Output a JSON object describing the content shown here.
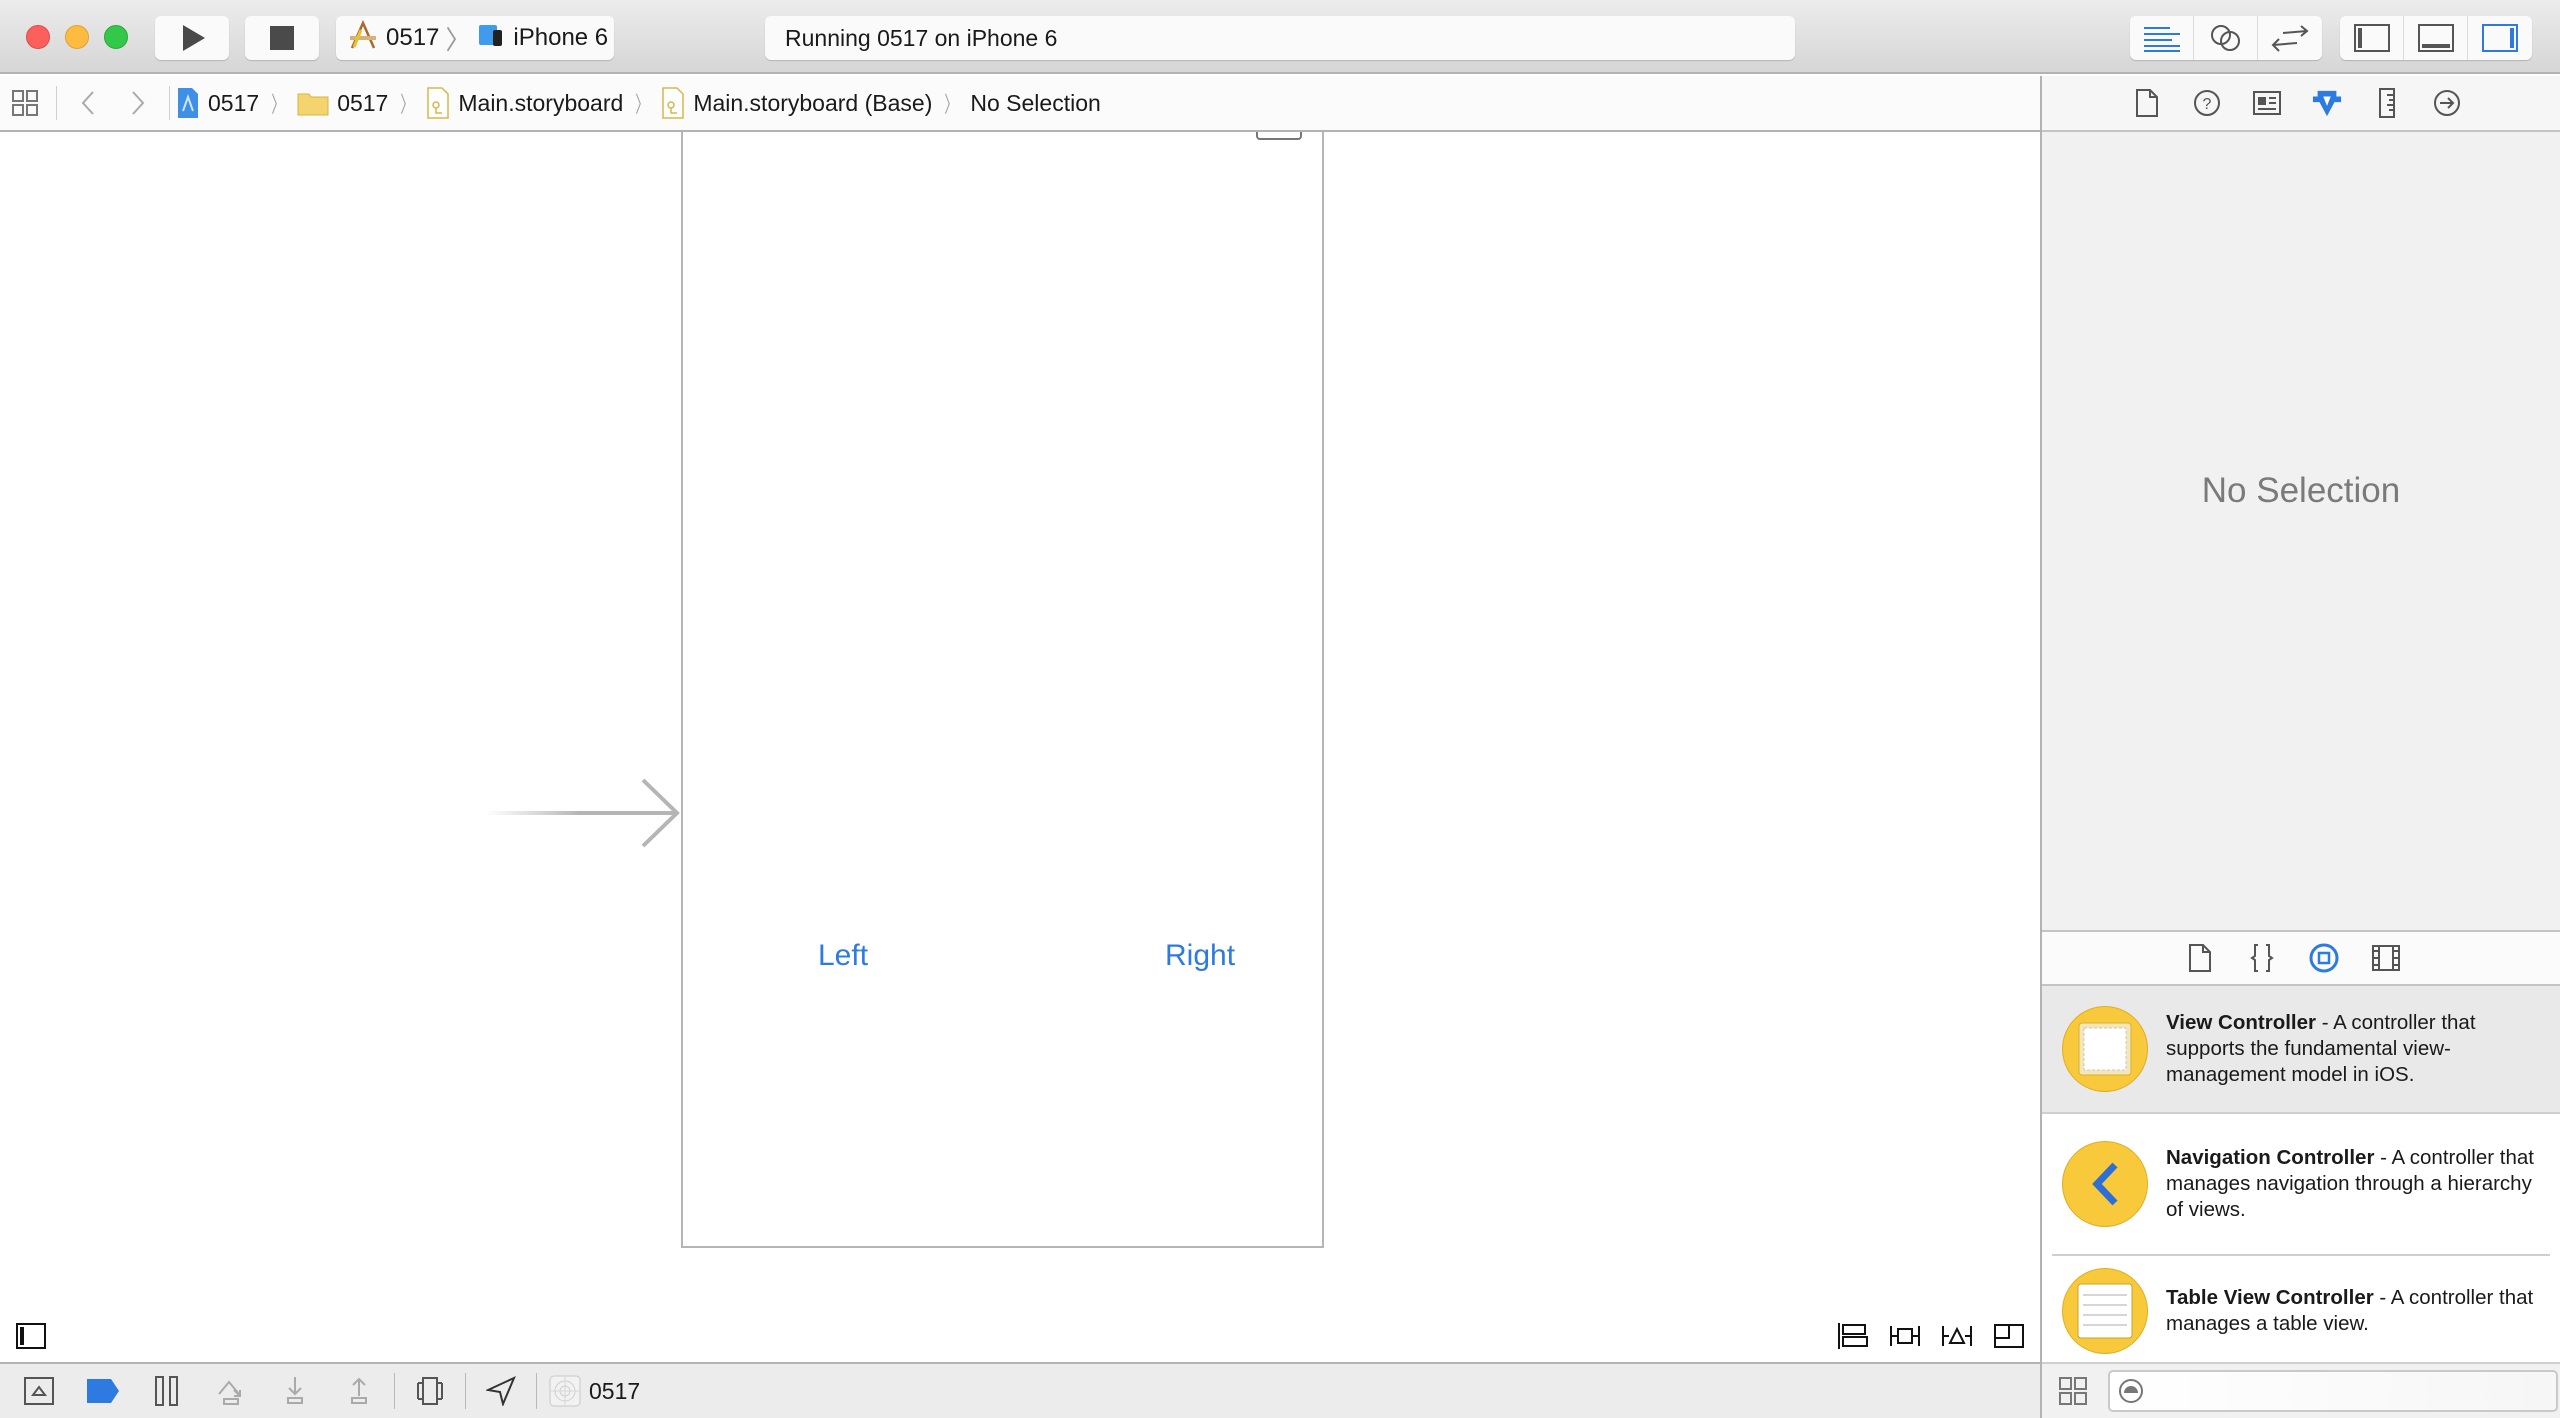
{
  "toolbar": {
    "run_label": "Run",
    "stop_label": "Stop",
    "scheme": {
      "project": "0517",
      "device": "iPhone 6"
    },
    "activity_status": "Running 0517 on iPhone 6",
    "editor_modes": [
      "standard-editor",
      "assistant-editor",
      "version-editor"
    ],
    "active_editor_mode": "standard-editor",
    "view_toggles": [
      "navigator",
      "debug-area",
      "utilities"
    ],
    "active_view_toggles": [
      "utilities"
    ],
    "accent_color": "#2d7be0"
  },
  "jumpbar": {
    "crumbs": [
      {
        "label": "0517",
        "icon": "project-icon"
      },
      {
        "label": "0517",
        "icon": "folder-icon"
      },
      {
        "label": "Main.storyboard",
        "icon": "storyboard-icon"
      },
      {
        "label": "Main.storyboard (Base)",
        "icon": "storyboard-icon"
      },
      {
        "label": "No Selection",
        "icon": ""
      }
    ]
  },
  "canvas": {
    "buttons": {
      "left": "Left",
      "right": "Right"
    },
    "button_color": "#2d7be0"
  },
  "debugbar": {
    "process_label": "0517"
  },
  "inspector": {
    "tabs": [
      "file",
      "quick-help",
      "identity",
      "attributes",
      "size",
      "connections"
    ],
    "active_tab": "attributes",
    "empty_message": "No Selection"
  },
  "library": {
    "tabs": [
      "file-template",
      "code-snippet",
      "object",
      "media"
    ],
    "active_tab": "object",
    "items": [
      {
        "title": "View Controller",
        "description": " - A controller that supports the fundamental view-management model in iOS.",
        "selected": true
      },
      {
        "title": "Navigation Controller",
        "description": " - A controller that manages navigation through a hierarchy of views.",
        "selected": false
      },
      {
        "title": "Table View Controller",
        "description": " - A controller that manages a table view.",
        "selected": false
      }
    ],
    "filter_placeholder": "",
    "filter_value": ""
  }
}
